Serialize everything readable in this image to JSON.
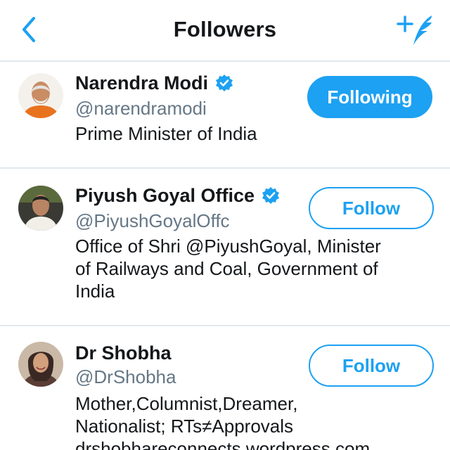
{
  "header": {
    "title": "Followers",
    "back_icon": "chevron-left-icon",
    "compose_icon": "compose-tweet-icon",
    "accent_color": "#1da1f2"
  },
  "users": [
    {
      "name": "Narendra Modi",
      "verified": true,
      "handle": "@narendramodi",
      "bio_lines": [
        "Prime Minister of India"
      ],
      "button_label": "Following",
      "following": true
    },
    {
      "name": "Piyush Goyal Office",
      "verified": true,
      "handle": "@PiyushGoyalOffc",
      "bio_lines": [
        "Office of Shri @PiyushGoyal, Minister",
        "of Railways and Coal, Government of",
        "India"
      ],
      "button_label": "Follow",
      "following": false
    },
    {
      "name": "Dr Shobha",
      "verified": false,
      "handle": "@DrShobha",
      "bio_lines": [
        "Mother,Columnist,Dreamer,",
        "Nationalist; RTs≠Approvals",
        "drshobhareconnects.wordpress.com"
      ],
      "button_label": "Follow",
      "following": false
    }
  ]
}
